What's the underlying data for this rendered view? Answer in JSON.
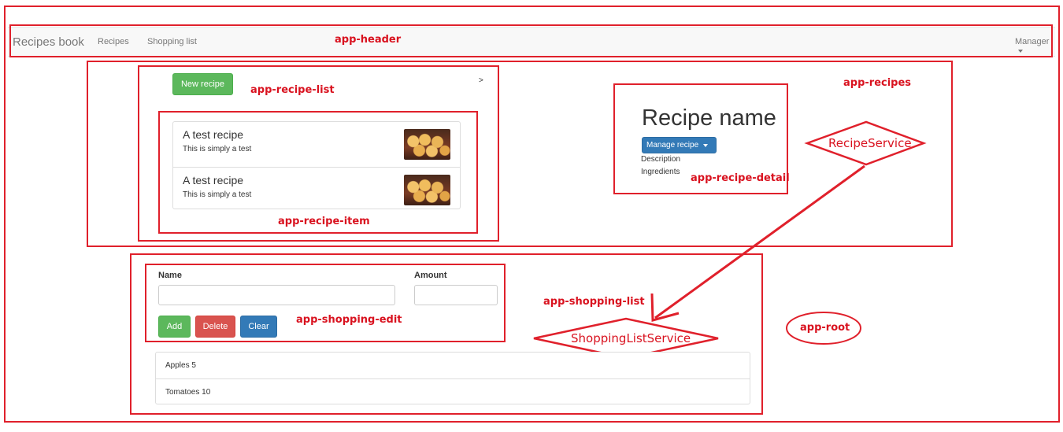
{
  "header": {
    "brand": "Recipes book",
    "nav": [
      "Recipes",
      "Shopping list"
    ],
    "manage_label": "Manager"
  },
  "recipe_list": {
    "new_recipe_label": "New recipe",
    "arrow": ">",
    "items": [
      {
        "name": "A test recipe",
        "description": "This is simply a test",
        "image_icon": "recipe-photo"
      },
      {
        "name": "A test recipe",
        "description": "This is simply a test",
        "image_icon": "recipe-photo"
      }
    ]
  },
  "recipe_detail": {
    "name": "Recipe name",
    "manage_label": "Manage recipe",
    "description_label": "Description",
    "ingredients_label": "Ingredients"
  },
  "shopping_edit": {
    "name_label": "Name",
    "amount_label": "Amount",
    "name_value": "",
    "amount_value": "",
    "add_label": "Add",
    "delete_label": "Delete",
    "clear_label": "Clear"
  },
  "shopping_list": {
    "items": [
      "Apples 5",
      "Tomatoes 10"
    ]
  },
  "annotations": {
    "app_header": "app-header",
    "app_recipes": "app-recipes",
    "app_recipe_list": "app-recipe-list",
    "app_recipe_item": "app-recipe-item",
    "app_recipe_detail": "app-recipe-detail",
    "recipe_service": "RecipeService",
    "app_shopping_list": "app-shopping-list",
    "app_shopping_edit": "app-shopping-edit",
    "shopping_list_service": "ShoppingListService",
    "app_root": "app-root"
  },
  "colors": {
    "annotation_red": "#e0202b",
    "success": "#5cb85c",
    "danger": "#d9534f",
    "primary": "#337ab7"
  }
}
